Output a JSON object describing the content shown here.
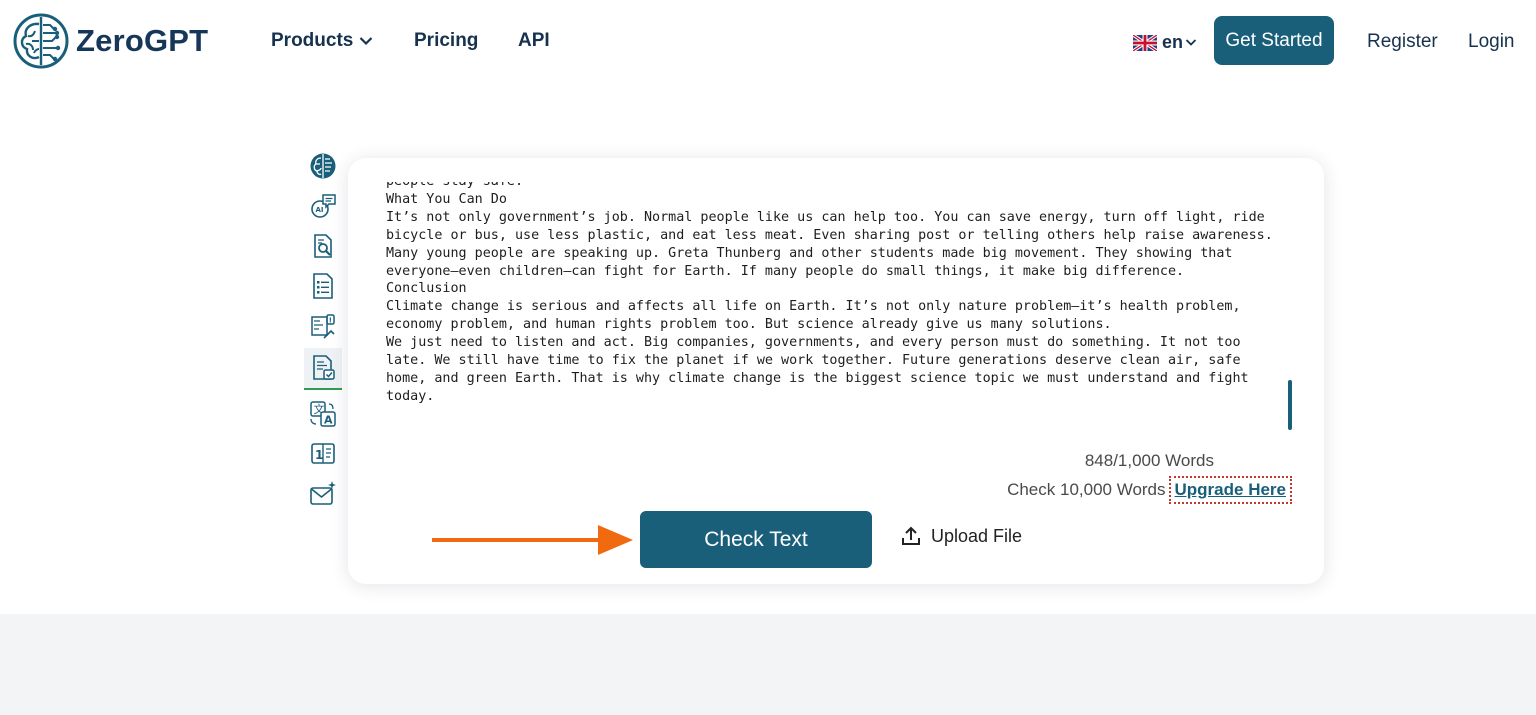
{
  "header": {
    "brand": "ZeroGPT",
    "nav": [
      {
        "label": "Products",
        "has_dropdown": true
      },
      {
        "label": "Pricing"
      },
      {
        "label": "API"
      }
    ],
    "language": "en",
    "get_started_label": "Get Started",
    "register_label": "Register",
    "login_label": "Login"
  },
  "tools": [
    {
      "icon": "brain-icon"
    },
    {
      "icon": "ai-chat-icon"
    },
    {
      "icon": "document-search-icon"
    },
    {
      "icon": "document-list-icon"
    },
    {
      "icon": "grammar-check-icon"
    },
    {
      "icon": "document-check-icon",
      "active": true
    },
    {
      "icon": "translate-icon"
    },
    {
      "icon": "word-counter-icon"
    },
    {
      "icon": "email-sparkle-icon"
    }
  ],
  "editor": {
    "lines": [
      "people stay safe.",
      "What You Can Do",
      "It’s not only government’s job. Normal people like us can help too. You can save energy, turn off light, ride",
      "bicycle or bus, use less plastic, and eat less meat. Even sharing post or telling others help raise awareness.",
      "Many young people are speaking up. Greta Thunberg and other students made big movement. They showing that",
      "everyone—even children—can fight for Earth. If many people do small things, it make big difference.",
      "Conclusion",
      "Climate change is serious and affects all life on Earth. It’s not only nature problem—it’s health problem,",
      "economy problem, and human rights problem too. But science already give us many solutions.",
      "We just need to listen and act. Big companies, governments, and every person must do something. It not too",
      "late. We still have time to fix the planet if we work together. Future generations deserve clean air, safe",
      "home, and green Earth. That is why climate change is the biggest science topic we must understand and fight",
      "today."
    ],
    "word_count": "848/1,000 Words",
    "upgrade_prefix": "Check 10,000 Words",
    "upgrade_link": "Upgrade Here"
  },
  "actions": {
    "check_label": "Check Text",
    "upload_label": "Upload File"
  },
  "colors": {
    "primary": "#1a5f7a",
    "navy_text": "#16324f",
    "arrow": "#f26a10",
    "highlight_border": "#c0392b"
  }
}
